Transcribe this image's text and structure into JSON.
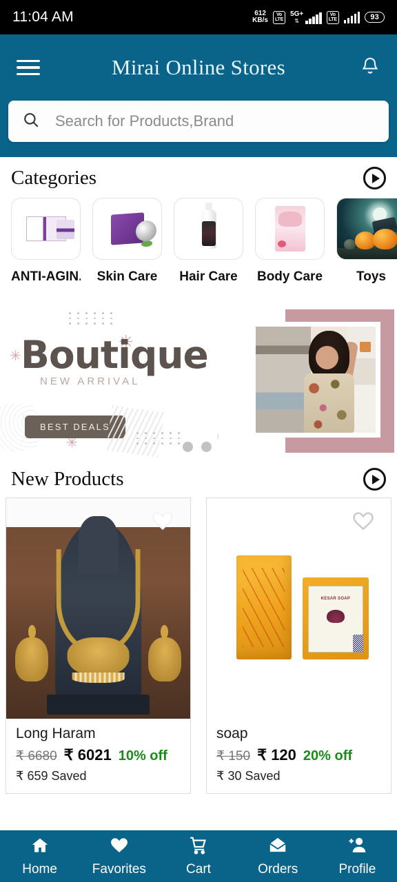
{
  "status_bar": {
    "time": "11:04 AM",
    "data_rate_value": "612",
    "data_rate_unit": "KB/s",
    "sim1_volte": "VoLTE",
    "network_type": "5G+",
    "sim2_volte": "VoLTE",
    "battery": "93"
  },
  "header": {
    "title": "Mirai Online Stores",
    "menu_icon": "hamburger-menu-icon",
    "bell_icon": "notification-bell-icon"
  },
  "search": {
    "placeholder": "Search for Products,Brand",
    "value": "",
    "icon": "search-icon"
  },
  "categories_section": {
    "title": "Categories",
    "next_icon": "play-arrow-icon",
    "items": [
      {
        "label": "ANTI-AGIN...",
        "thumb": "anti-aging-cream-box"
      },
      {
        "label": "Skin Care",
        "thumb": "skin-care-purple-box"
      },
      {
        "label": "Hair Care",
        "thumb": "hair-care-bottle"
      },
      {
        "label": "Body Care",
        "thumb": "body-care-pink-pack"
      },
      {
        "label": "Toys",
        "thumb": "halloween-pumpkins"
      }
    ]
  },
  "banner": {
    "headline": "Boutique",
    "subtitle": "NEW ARRIVAL",
    "cta_label": "BEST DEALS",
    "social_glyphs": "f",
    "dots_count": 2
  },
  "new_products_section": {
    "title": "New Products",
    "next_icon": "play-arrow-icon",
    "products": [
      {
        "name": "Long Haram",
        "old_price": "₹ 6680",
        "new_price": "₹ 6021",
        "discount": "10% off",
        "saved": "₹ 659 Saved",
        "image": "gold-necklace-set",
        "favorite_icon": "heart-icon",
        "favorited": true
      },
      {
        "name": "soap",
        "old_price": "₹ 150",
        "new_price": "₹ 120",
        "discount": "20% off",
        "saved": "₹ 30 Saved",
        "image": "kesar-soap-bars",
        "favorite_icon": "heart-icon",
        "favorited": false
      }
    ]
  },
  "bottom_nav": {
    "items": [
      {
        "label": "Home",
        "icon": "home-icon"
      },
      {
        "label": "Favorites",
        "icon": "heart-icon"
      },
      {
        "label": "Cart",
        "icon": "shopping-cart-icon"
      },
      {
        "label": "Orders",
        "icon": "envelope-icon"
      },
      {
        "label": "Profile",
        "icon": "add-person-icon"
      }
    ],
    "active": "Home"
  },
  "colors": {
    "primary_teal": "#0a6489",
    "discount_green": "#1a8a1a",
    "banner_frame_rose": "#c79aa1",
    "status_bar_bg": "#000000"
  }
}
